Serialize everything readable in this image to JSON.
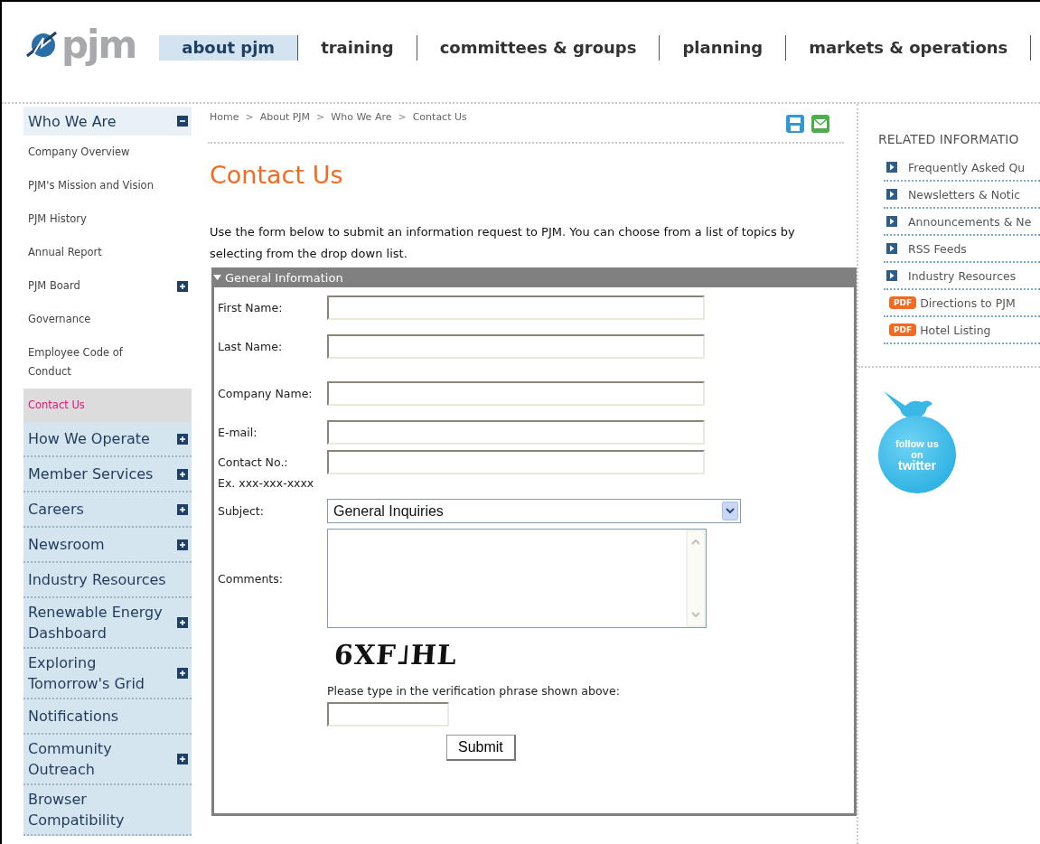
{
  "logo": {
    "text": "pjm"
  },
  "nav": [
    {
      "label": "about pjm",
      "selected": true
    },
    {
      "label": "training",
      "selected": false
    },
    {
      "label": "committees & groups",
      "selected": false
    },
    {
      "label": "planning",
      "selected": false
    },
    {
      "label": "markets & operations",
      "selected": false
    }
  ],
  "sidebar": {
    "sections": [
      {
        "label": "Who We Are",
        "expandable": true,
        "expanded": true,
        "children": [
          {
            "label": "Company Overview",
            "selected": false,
            "expandable": false
          },
          {
            "label": "PJM's Mission and Vision",
            "selected": false,
            "expandable": false
          },
          {
            "label": "PJM History",
            "selected": false,
            "expandable": false
          },
          {
            "label": "Annual Report",
            "selected": false,
            "expandable": false
          },
          {
            "label": "PJM Board",
            "selected": false,
            "expandable": true
          },
          {
            "label": "Governance",
            "selected": false,
            "expandable": false
          },
          {
            "label": "Employee Code of Conduct",
            "selected": false,
            "expandable": false
          },
          {
            "label": "Contact Us",
            "selected": true,
            "expandable": false
          }
        ]
      },
      {
        "label": "How We Operate",
        "expandable": true,
        "expanded": false
      },
      {
        "label": "Member Services",
        "expandable": true,
        "expanded": false
      },
      {
        "label": "Careers",
        "expandable": true,
        "expanded": false
      },
      {
        "label": "Newsroom",
        "expandable": true,
        "expanded": false
      },
      {
        "label": "Industry Resources",
        "expandable": false
      },
      {
        "label": "Renewable Energy Dashboard",
        "expandable": true,
        "expanded": false
      },
      {
        "label": "Exploring Tomorrow's Grid",
        "expandable": true,
        "expanded": false
      },
      {
        "label": "Notifications",
        "expandable": false
      },
      {
        "label": "Community Outreach",
        "expandable": true,
        "expanded": false
      },
      {
        "label": "Browser Compatibility",
        "expandable": false
      }
    ]
  },
  "breadcrumb": [
    "Home",
    ">",
    "About PJM",
    ">",
    "Who We Are",
    ">",
    "Contact Us"
  ],
  "page_title": "Contact Us",
  "intro": "Use the form below to submit an information request to PJM. You can choose from a list of topics by selecting from the drop down list.",
  "form": {
    "panel_title": "General Information",
    "expanded": true,
    "fields": [
      {
        "kind": "text",
        "label": "First Name:"
      },
      {
        "kind": "text",
        "label": "Last Name:"
      },
      {
        "kind": "text",
        "label": "Company Name:"
      },
      {
        "kind": "text",
        "label": "E-mail:"
      },
      {
        "kind": "text",
        "label": "Contact No.:",
        "hint": "Ex. xxx-xxx-xxxx"
      },
      {
        "kind": "select",
        "label": "Subject:",
        "value": "General Inquiries"
      },
      {
        "kind": "textarea",
        "label": "Comments:"
      }
    ],
    "captcha": "6XF˩HL",
    "captcha_prompt": "Please type in the verification phrase shown above:",
    "submit": "Submit"
  },
  "related": {
    "title": "RELATED INFORMATIO",
    "links": [
      {
        "kind": "arrow",
        "label": "Frequently Asked Qu"
      },
      {
        "kind": "arrow",
        "label": "Newsletters & Notic"
      },
      {
        "kind": "arrow",
        "label": "Announcements & Ne"
      },
      {
        "kind": "arrow",
        "label": "RSS Feeds"
      },
      {
        "kind": "arrow",
        "label": "Industry Resources"
      },
      {
        "kind": "pdf",
        "badge": "PDF",
        "label": "Directions to PJM"
      },
      {
        "kind": "pdf",
        "badge": "PDF",
        "label": "Hotel Listing"
      }
    ]
  },
  "twitter_badge": {
    "lines": [
      "follow us",
      "on",
      "twitter"
    ]
  }
}
